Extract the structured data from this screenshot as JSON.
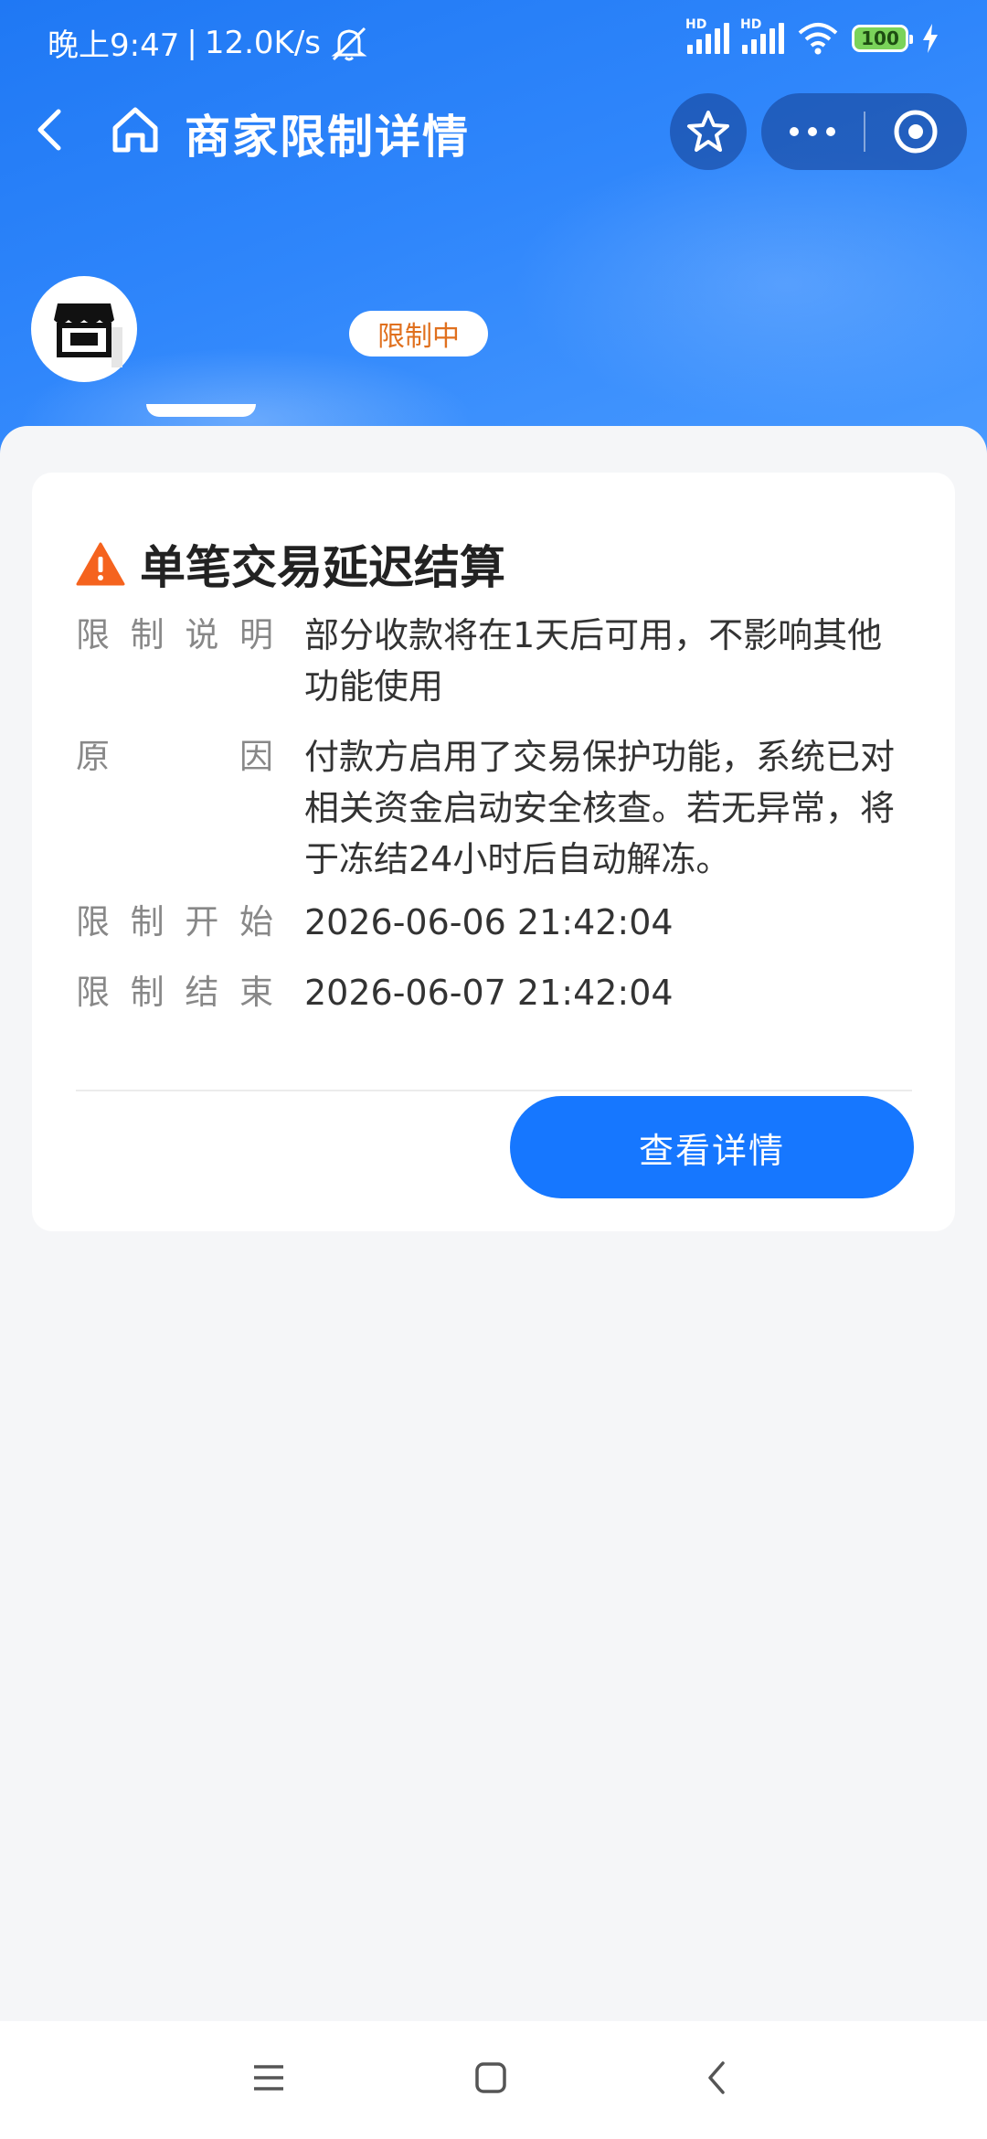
{
  "status_bar": {
    "time": "晚上9:47",
    "net_speed": "12.0K/s",
    "signal1_label": "HD",
    "signal2_label": "HD",
    "battery": "100"
  },
  "nav": {
    "title": "商家限制详情",
    "icons": [
      "back-icon",
      "home-icon",
      "star-icon",
      "more-icon",
      "target-icon"
    ]
  },
  "merchant": {
    "status_badge": "限制中",
    "avatar_icon": "store-icon"
  },
  "card": {
    "title": "单笔交易延迟结算",
    "title_icon": "warning-icon",
    "rows": [
      {
        "label": [
          "限",
          "制",
          "说",
          "明"
        ],
        "value": "部分收款将在1天后可用，不影响其他功能使用"
      },
      {
        "label": [
          "原",
          "因"
        ],
        "value": "付款方启用了交易保护功能，系统已对相关资金启动安全核查。若无异常，将于冻结24小时后自动解冻。"
      },
      {
        "label": [
          "限",
          "制",
          "开",
          "始"
        ],
        "value": "2026-06-06 21:42:04"
      },
      {
        "label": [
          "限",
          "制",
          "结",
          "束"
        ],
        "value": "2026-06-07 21:42:04"
      }
    ],
    "button_label": "查看详情"
  },
  "system_nav": {
    "icons": [
      "menu-icon",
      "home-square-icon",
      "back-chevron-icon"
    ]
  },
  "colors": {
    "accent": "#1677ff",
    "badge_text": "#e0701e",
    "warning": "#f5631e"
  }
}
